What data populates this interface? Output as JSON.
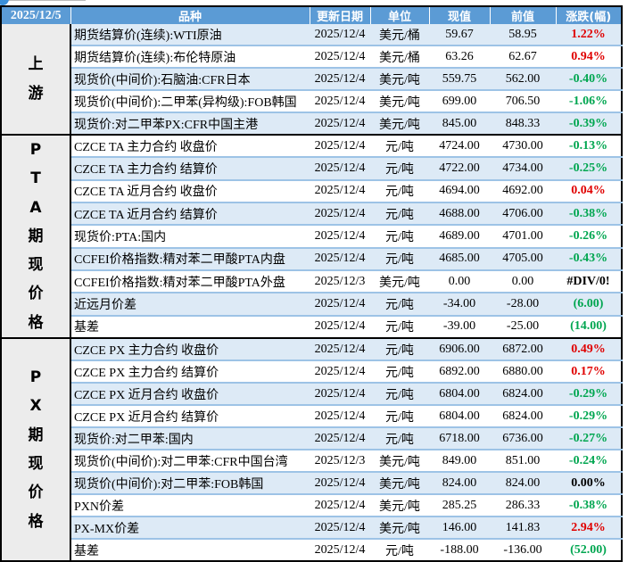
{
  "header": {
    "date": "2025/12/5",
    "cols": [
      "品种",
      "更新日期",
      "单位",
      "现值",
      "前值",
      "涨跌(幅)"
    ]
  },
  "colors": {
    "header_bg": "#5b9bd5",
    "up": "#e00000",
    "down": "#00a650",
    "row_alt": "#ddeaf6"
  },
  "groups": [
    {
      "label": "上游",
      "rows": [
        {
          "name": "期货结算价(连续):WTI原油",
          "date": "2025/12/4",
          "unit": "美元/桶",
          "current": "59.67",
          "previous": "58.95",
          "change": "1.22%",
          "trend": "up"
        },
        {
          "name": "期货结算价(连续):布伦特原油",
          "date": "2025/12/4",
          "unit": "美元/桶",
          "current": "63.26",
          "previous": "62.67",
          "change": "0.94%",
          "trend": "up"
        },
        {
          "name": "现货价(中间价):石脑油:CFR日本",
          "date": "2025/12/4",
          "unit": "美元/吨",
          "current": "559.75",
          "previous": "562.00",
          "change": "-0.40%",
          "trend": "down"
        },
        {
          "name": "现货价(中间价):二甲苯(异构级):FOB韩国",
          "date": "2025/12/4",
          "unit": "美元/吨",
          "current": "699.00",
          "previous": "706.50",
          "change": "-1.06%",
          "trend": "down"
        },
        {
          "name": "现货价:对二甲苯PX:CFR中国主港",
          "date": "2025/12/4",
          "unit": "美元/吨",
          "current": "845.00",
          "previous": "848.33",
          "change": "-0.39%",
          "trend": "down"
        }
      ]
    },
    {
      "label": "PTA期现价格",
      "rows": [
        {
          "name": "CZCE TA 主力合约 收盘价",
          "date": "2025/12/4",
          "unit": "元/吨",
          "current": "4724.00",
          "previous": "4730.00",
          "change": "-0.13%",
          "trend": "down"
        },
        {
          "name": "CZCE TA 主力合约 结算价",
          "date": "2025/12/4",
          "unit": "元/吨",
          "current": "4722.00",
          "previous": "4734.00",
          "change": "-0.25%",
          "trend": "down"
        },
        {
          "name": "CZCE TA 近月合约 收盘价",
          "date": "2025/12/4",
          "unit": "元/吨",
          "current": "4694.00",
          "previous": "4692.00",
          "change": "0.04%",
          "trend": "up"
        },
        {
          "name": "CZCE TA 近月合约 结算价",
          "date": "2025/12/4",
          "unit": "元/吨",
          "current": "4688.00",
          "previous": "4706.00",
          "change": "-0.38%",
          "trend": "down"
        },
        {
          "name": "现货价:PTA:国内",
          "date": "2025/12/4",
          "unit": "元/吨",
          "current": "4689.00",
          "previous": "4701.00",
          "change": "-0.26%",
          "trend": "down"
        },
        {
          "name": "CCFEI价格指数:精对苯二甲酸PTA内盘",
          "date": "2025/12/4",
          "unit": "元/吨",
          "current": "4685.00",
          "previous": "4705.00",
          "change": "-0.43%",
          "trend": "down"
        },
        {
          "name": "CCFEI价格指数:精对苯二甲酸PTA外盘",
          "date": "2025/12/3",
          "unit": "美元/吨",
          "current": "0.00",
          "previous": "0.00",
          "change": "#DIV/0!",
          "trend": "flat"
        },
        {
          "name": "近远月价差",
          "date": "2025/12/4",
          "unit": "元/吨",
          "current": "-34.00",
          "previous": "-28.00",
          "change": "(6.00)",
          "trend": "down"
        },
        {
          "name": "基差",
          "date": "2025/12/4",
          "unit": "元/吨",
          "current": "-39.00",
          "previous": "-25.00",
          "change": "(14.00)",
          "trend": "down"
        }
      ]
    },
    {
      "label": "PX期现价格",
      "rows": [
        {
          "name": "CZCE PX 主力合约 收盘价",
          "date": "2025/12/4",
          "unit": "元/吨",
          "current": "6906.00",
          "previous": "6872.00",
          "change": "0.49%",
          "trend": "up"
        },
        {
          "name": "CZCE PX 主力合约 结算价",
          "date": "2025/12/4",
          "unit": "元/吨",
          "current": "6892.00",
          "previous": "6880.00",
          "change": "0.17%",
          "trend": "up"
        },
        {
          "name": "CZCE PX 近月合约 收盘价",
          "date": "2025/12/4",
          "unit": "元/吨",
          "current": "6804.00",
          "previous": "6824.00",
          "change": "-0.29%",
          "trend": "down"
        },
        {
          "name": "CZCE PX 近月合约 结算价",
          "date": "2025/12/4",
          "unit": "元/吨",
          "current": "6804.00",
          "previous": "6824.00",
          "change": "-0.29%",
          "trend": "down"
        },
        {
          "name": "现货价:对二甲苯:国内",
          "date": "2025/12/4",
          "unit": "元/吨",
          "current": "6718.00",
          "previous": "6736.00",
          "change": "-0.27%",
          "trend": "down"
        },
        {
          "name": "现货价(中间价):对二甲苯:CFR中国台湾",
          "date": "2025/12/3",
          "unit": "美元/吨",
          "current": "849.00",
          "previous": "851.00",
          "change": "-0.24%",
          "trend": "down"
        },
        {
          "name": "现货价(中间价):对二甲苯:FOB韩国",
          "date": "2025/12/4",
          "unit": "美元/吨",
          "current": "824.00",
          "previous": "824.00",
          "change": "0.00%",
          "trend": "flat"
        },
        {
          "name": "PXN价差",
          "date": "2025/12/4",
          "unit": "美元/吨",
          "current": "285.25",
          "previous": "286.33",
          "change": "-0.38%",
          "trend": "down"
        },
        {
          "name": "PX-MX价差",
          "date": "2025/12/4",
          "unit": "美元/吨",
          "current": "146.00",
          "previous": "141.83",
          "change": "2.94%",
          "trend": "up"
        },
        {
          "name": "基差",
          "date": "2025/12/4",
          "unit": "元/吨",
          "current": "-188.00",
          "previous": "-136.00",
          "change": "(52.00)",
          "trend": "down"
        }
      ]
    }
  ]
}
